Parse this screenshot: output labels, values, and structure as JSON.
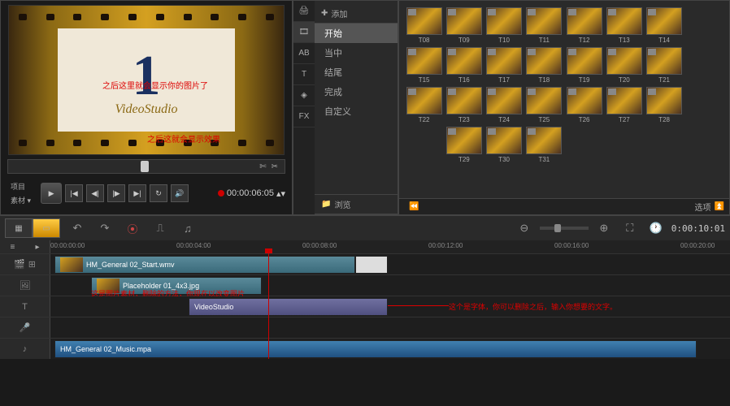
{
  "preview": {
    "number": "1",
    "brand": "VideoStudio",
    "annotation1": "之后这里就会显示你的图片了",
    "annotation2": "之后这就会显示效果",
    "tab_project": "项目",
    "tab_clip": "素材 ▾",
    "timecode": "00:00:06:05"
  },
  "sidebar": {
    "add": "添加",
    "browse": "浏览",
    "options": "选项",
    "items": [
      "开始",
      "当中",
      "结尾",
      "完成",
      "自定义"
    ]
  },
  "library": {
    "thumbs": [
      "T08",
      "T09",
      "T10",
      "T11",
      "T12",
      "T13",
      "T14",
      "",
      "T15",
      "T16",
      "T17",
      "T18",
      "T19",
      "T20",
      "T21",
      "",
      "T22",
      "T23",
      "T24",
      "T25",
      "T26",
      "T27",
      "T28",
      "",
      "",
      "T29",
      "T30",
      "T31",
      "",
      "",
      "",
      ""
    ]
  },
  "timeline": {
    "ruler": [
      "00:00:00:00",
      "00:00:04:00",
      "00:00:08:00",
      "00:00:12:00",
      "00:00:16:00",
      "00:00:20:00"
    ],
    "timecode": "0:00:10:01",
    "clips": {
      "video": "HM_General 02_Start.wmv",
      "overlay": "Placeholder 01_4x3.jpg",
      "overlay_note": "这是图片素材，删除的方法，你现在以改变图片",
      "title": "VideoStudio",
      "title_note": "这个是字体，你可以删除之后，输入你想要的文字。",
      "audio": "HM_General 02_Music.mpa"
    }
  }
}
